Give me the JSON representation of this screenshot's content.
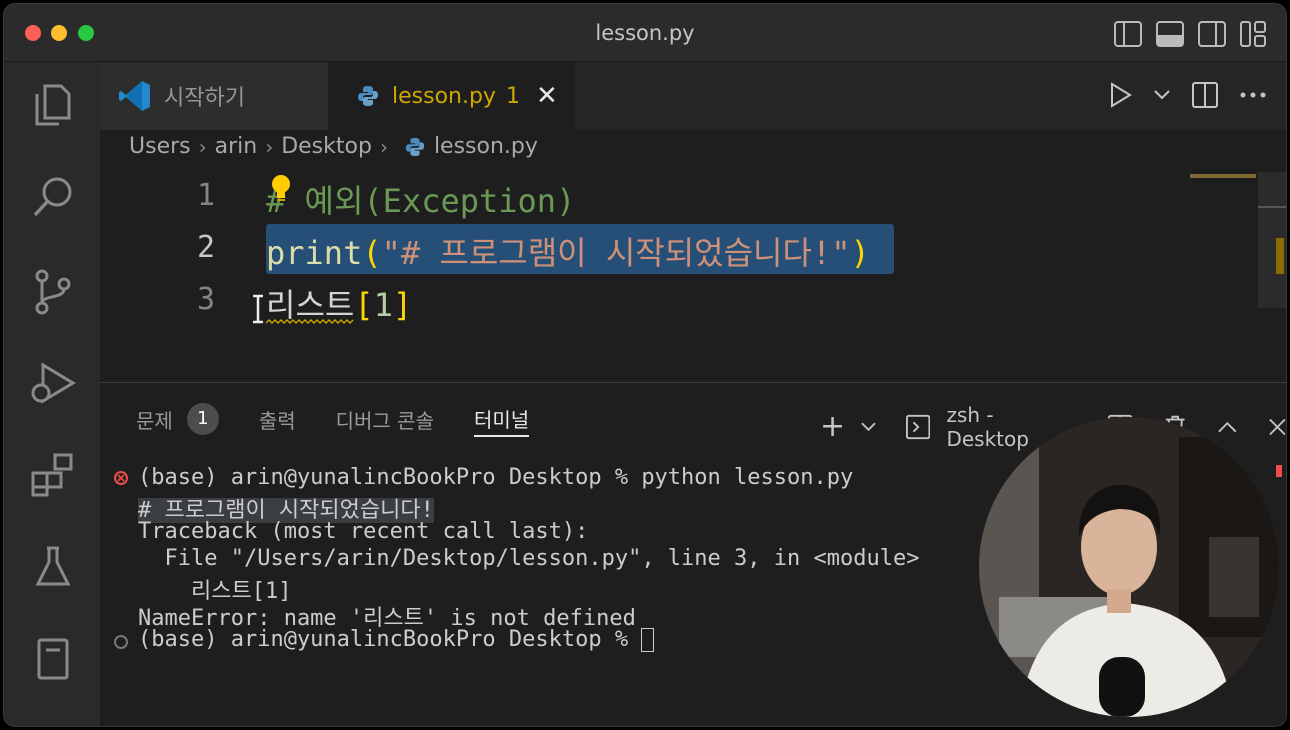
{
  "window": {
    "title": "lesson.py"
  },
  "tabs": [
    {
      "label": "시작하기"
    },
    {
      "label": "lesson.py",
      "problems": "1"
    }
  ],
  "breadcrumb": [
    "Users",
    "arin",
    "Desktop",
    "lesson.py"
  ],
  "editor": {
    "lines": [
      {
        "number": "1",
        "hash": "#",
        "comment": " 예외(Exception)"
      },
      {
        "number": "2",
        "fn": "print",
        "open": "(",
        "string": "\"# 프로그램이 시작되었습니다!\"",
        "close": ")"
      },
      {
        "number": "3",
        "ident": "리스트",
        "open": "[",
        "num": "1",
        "close": "]"
      }
    ]
  },
  "panel": {
    "tabs": [
      {
        "label": "문제",
        "badge": "1"
      },
      {
        "label": "출력"
      },
      {
        "label": "디버그 콘솔"
      },
      {
        "label": "터미널"
      }
    ],
    "terminal_name": "zsh - Desktop"
  },
  "terminal": {
    "lines": [
      "(base) arin@yunalincBookPro Desktop % python lesson.py",
      "# 프로그램이 시작되었습니다!",
      "Traceback (most recent call last):",
      "  File \"/Users/arin/Desktop/lesson.py\", line 3, in <module>",
      "    리스트[1]",
      "NameError: name '리스트' is not defined",
      "(base) arin@yunalincBookPro Desktop % "
    ]
  },
  "colors": {
    "accent": "#007acc",
    "error": "#f14c4c",
    "warning": "#cca700",
    "selection": "#264f78"
  }
}
